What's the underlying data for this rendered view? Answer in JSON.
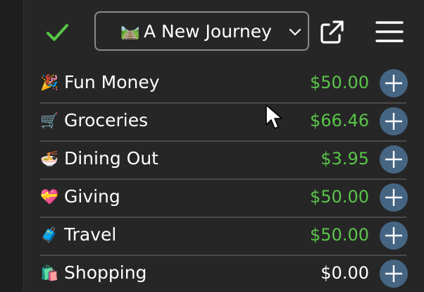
{
  "header": {
    "budget_emoji": "🛤️",
    "budget_name": "A New Journey"
  },
  "colors": {
    "accent_green": "#5ac44a",
    "amount_white": "#ffffff",
    "add_button": "#456583"
  },
  "categories": [
    {
      "emoji": "🎉",
      "name": "Fun Money",
      "amount": "$50.00",
      "amount_color": "#5ac44a"
    },
    {
      "emoji": "🛒",
      "name": "Groceries",
      "amount": "$66.46",
      "amount_color": "#5ac44a"
    },
    {
      "emoji": "🍜",
      "name": "Dining Out",
      "amount": "$3.95",
      "amount_color": "#5ac44a"
    },
    {
      "emoji": "💝",
      "name": "Giving",
      "amount": "$50.00",
      "amount_color": "#5ac44a"
    },
    {
      "emoji": "🧳",
      "name": "Travel",
      "amount": "$50.00",
      "amount_color": "#5ac44a"
    },
    {
      "emoji": "🛍️",
      "name": "Shopping",
      "amount": "$0.00",
      "amount_color": "#ffffff"
    }
  ],
  "icons": {
    "confirm": "check-icon",
    "dropdown": "chevron-down-icon",
    "open_external": "external-link-icon",
    "menu": "hamburger-menu-icon",
    "add": "plus-icon"
  }
}
